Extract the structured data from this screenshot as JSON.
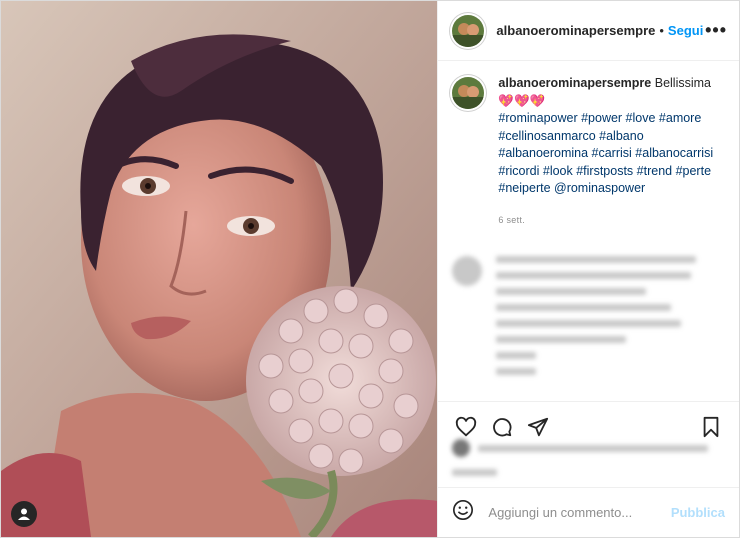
{
  "post": {
    "username": "albanoeromina​persempre",
    "follow_label": "Segui",
    "separator": "•",
    "more_label": "•••",
    "caption": {
      "username": "albanoerominapersempre",
      "text": "Bellissima",
      "emoji": "💖💖💖",
      "hashtags": "#rominapower #power #love #amore #cellinosanmarco #albano #albanoeromina #carrisi #albanocarrisi #ricordi #look #firstposts #trend #perte #neiperte @rominaspower"
    },
    "age": "6 sett.",
    "add_comment_placeholder": "Aggiungi un commento...",
    "publish_label": "Pubblica"
  },
  "icons": {
    "like": "heart-icon",
    "comment": "comment-icon",
    "share": "share-icon",
    "save": "bookmark-icon",
    "emoji": "emoji-icon",
    "tag": "user-tag-icon",
    "more": "more-icon"
  },
  "colors": {
    "accent": "#0095f6",
    "link": "#00376b",
    "muted": "#8e8e8e",
    "publish_disabled": "#b2dffc"
  }
}
